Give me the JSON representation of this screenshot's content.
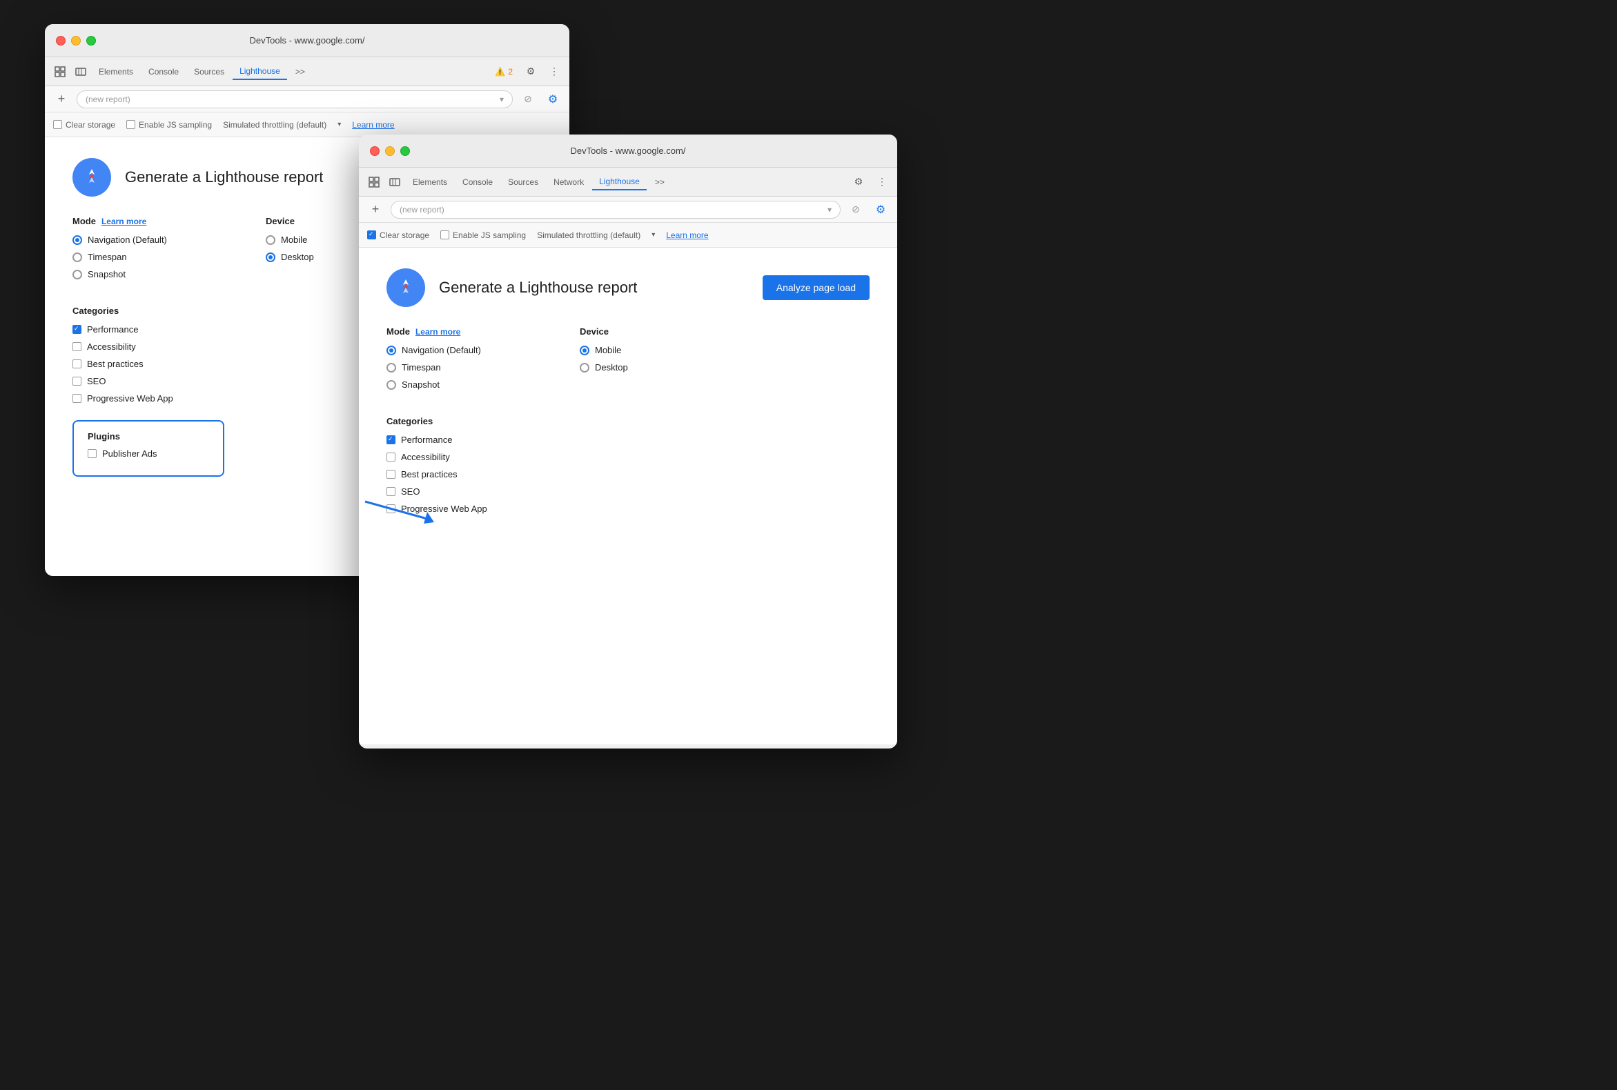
{
  "window1": {
    "title": "DevTools - www.google.com/",
    "tabs": [
      "Elements",
      "Console",
      "Sources",
      "Lighthouse",
      ">>"
    ],
    "active_tab": "Lighthouse",
    "warning_count": "2",
    "new_report_placeholder": "(new report)",
    "toolbar_row3": {
      "clear_storage_label": "Clear storage",
      "clear_storage_checked": false,
      "enable_js_label": "Enable JS sampling",
      "enable_js_checked": false,
      "throttling_label": "Simulated throttling (default)",
      "learn_more": "Learn more"
    },
    "content": {
      "title": "Generate a Lighthouse report",
      "mode_label": "Mode",
      "mode_learn_more": "Learn more",
      "device_label": "Device",
      "modes": [
        {
          "label": "Navigation (Default)",
          "selected": true
        },
        {
          "label": "Timespan",
          "selected": false
        },
        {
          "label": "Snapshot",
          "selected": false
        }
      ],
      "devices": [
        {
          "label": "Mobile",
          "selected": false
        },
        {
          "label": "Desktop",
          "selected": true
        }
      ],
      "categories_label": "Categories",
      "categories": [
        {
          "label": "Performance",
          "checked": true
        },
        {
          "label": "Accessibility",
          "checked": false
        },
        {
          "label": "Best practices",
          "checked": false
        },
        {
          "label": "SEO",
          "checked": false
        },
        {
          "label": "Progressive Web App",
          "checked": false
        }
      ],
      "plugins_label": "Plugins",
      "plugins": [
        {
          "label": "Publisher Ads",
          "checked": false
        }
      ]
    }
  },
  "window2": {
    "title": "DevTools - www.google.com/",
    "tabs": [
      "Elements",
      "Console",
      "Sources",
      "Network",
      "Lighthouse",
      ">>"
    ],
    "active_tab": "Lighthouse",
    "new_report_placeholder": "(new report)",
    "toolbar_row3": {
      "clear_storage_label": "Clear storage",
      "clear_storage_checked": true,
      "enable_js_label": "Enable JS sampling",
      "enable_js_checked": false,
      "throttling_label": "Simulated throttling (default)",
      "learn_more": "Learn more"
    },
    "content": {
      "title": "Generate a Lighthouse report",
      "analyze_btn": "Analyze page load",
      "mode_label": "Mode",
      "mode_learn_more": "Learn more",
      "device_label": "Device",
      "modes": [
        {
          "label": "Navigation (Default)",
          "selected": true
        },
        {
          "label": "Timespan",
          "selected": false
        },
        {
          "label": "Snapshot",
          "selected": false
        }
      ],
      "devices": [
        {
          "label": "Mobile",
          "selected": true
        },
        {
          "label": "Desktop",
          "selected": false
        }
      ],
      "categories_label": "Categories",
      "categories": [
        {
          "label": "Performance",
          "checked": true
        },
        {
          "label": "Accessibility",
          "checked": false
        },
        {
          "label": "Best practices",
          "checked": false
        },
        {
          "label": "SEO",
          "checked": false
        },
        {
          "label": "Progressive Web App",
          "checked": false
        }
      ]
    }
  },
  "icons": {
    "cursor": "⌖",
    "device": "▭",
    "gear": "⚙",
    "more": "⋮",
    "plus": "+",
    "cancel": "⊘",
    "settings": "⚙",
    "chevron_down": "▾",
    "warning": "⚠"
  }
}
